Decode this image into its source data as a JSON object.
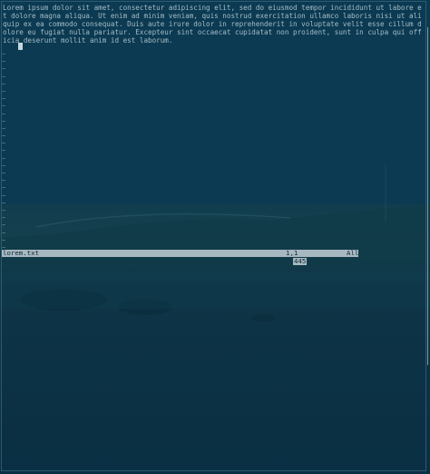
{
  "editor": {
    "text": "Lorem ipsum dolor sit amet, consectetur adipiscing elit, sed do eiusmod tempor incididunt ut labore et dolore magna aliqua. Ut enim ad minim veniam, quis nostrud exercitation ullamco laboris nisi ut aliquip ex ea commodo consequat. Duis aute irure dolor in reprehenderit in voluptate velit esse cillum dolore eu fugiat nulla pariatur. Excepteur sint occaecat cupidatat non proident, sunt in culpa qui officia deserunt mollit anim id est laborum.",
    "empty_line_marker": "~",
    "empty_line_count": 27
  },
  "statusline": {
    "filename": "lorem.txt",
    "position": "1,1",
    "percent": "All"
  },
  "cmdline": {
    "message": "445"
  },
  "colors": {
    "background": "#0b3a52",
    "text": "#a6bcc6",
    "statusline_bg": "#a8b8c0",
    "statusline_fg": "#0b2a3a"
  }
}
